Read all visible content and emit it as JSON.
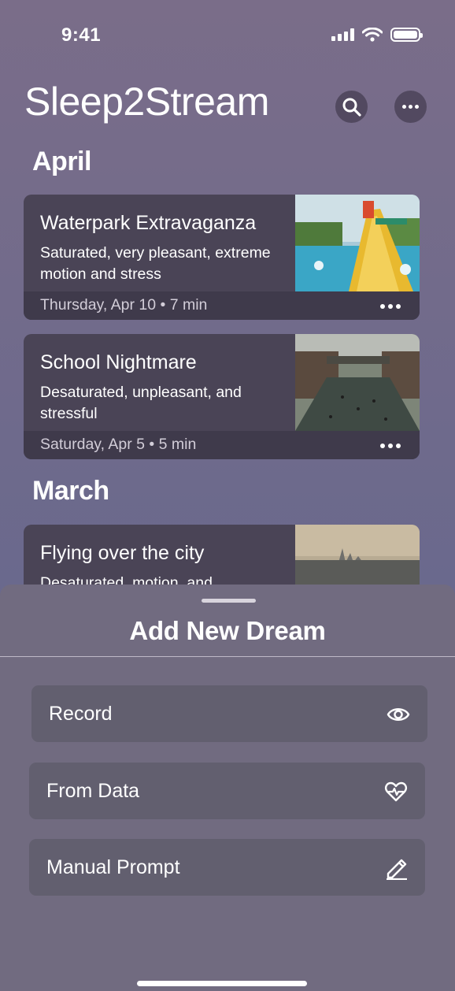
{
  "status": {
    "time": "9:41",
    "icons": [
      "cellular-signal-icon",
      "wifi-icon",
      "battery-icon"
    ]
  },
  "header": {
    "title": "Sleep2Stream",
    "search_icon": "search-icon",
    "more_icon": "more-icon"
  },
  "sections": [
    {
      "title": "April",
      "dreams": [
        {
          "title": "Waterpark Extravaganza",
          "description": "Saturated, very pleasant, extreme motion and stress",
          "meta": "Thursday, Apr 10 • 7 min",
          "thumbnail": "waterpark slide photo"
        },
        {
          "title": "School Nightmare",
          "description": "Desaturated, unpleasant,  and stressful",
          "meta": "Saturday, Apr 5 • 5 min",
          "thumbnail": "school courtyard photo"
        }
      ]
    },
    {
      "title": "March",
      "dreams": [
        {
          "title": "Flying over the city",
          "description": "Desaturated, motion, and",
          "thumbnail": "city skyline photo"
        }
      ]
    }
  ],
  "sheet": {
    "title": "Add New Dream",
    "options": [
      {
        "label": "Record",
        "icon": "eye-icon"
      },
      {
        "label": "From Data",
        "icon": "heart-pulse-icon"
      },
      {
        "label": "Manual Prompt",
        "icon": "pencil-icon"
      }
    ]
  },
  "colors": {
    "background_top": "#7a6d89",
    "background_bottom": "#5f6590",
    "card": "#4a4456",
    "card_footer": "#3f3a4b",
    "sheet": "#716b80",
    "option": "#625f6f"
  }
}
